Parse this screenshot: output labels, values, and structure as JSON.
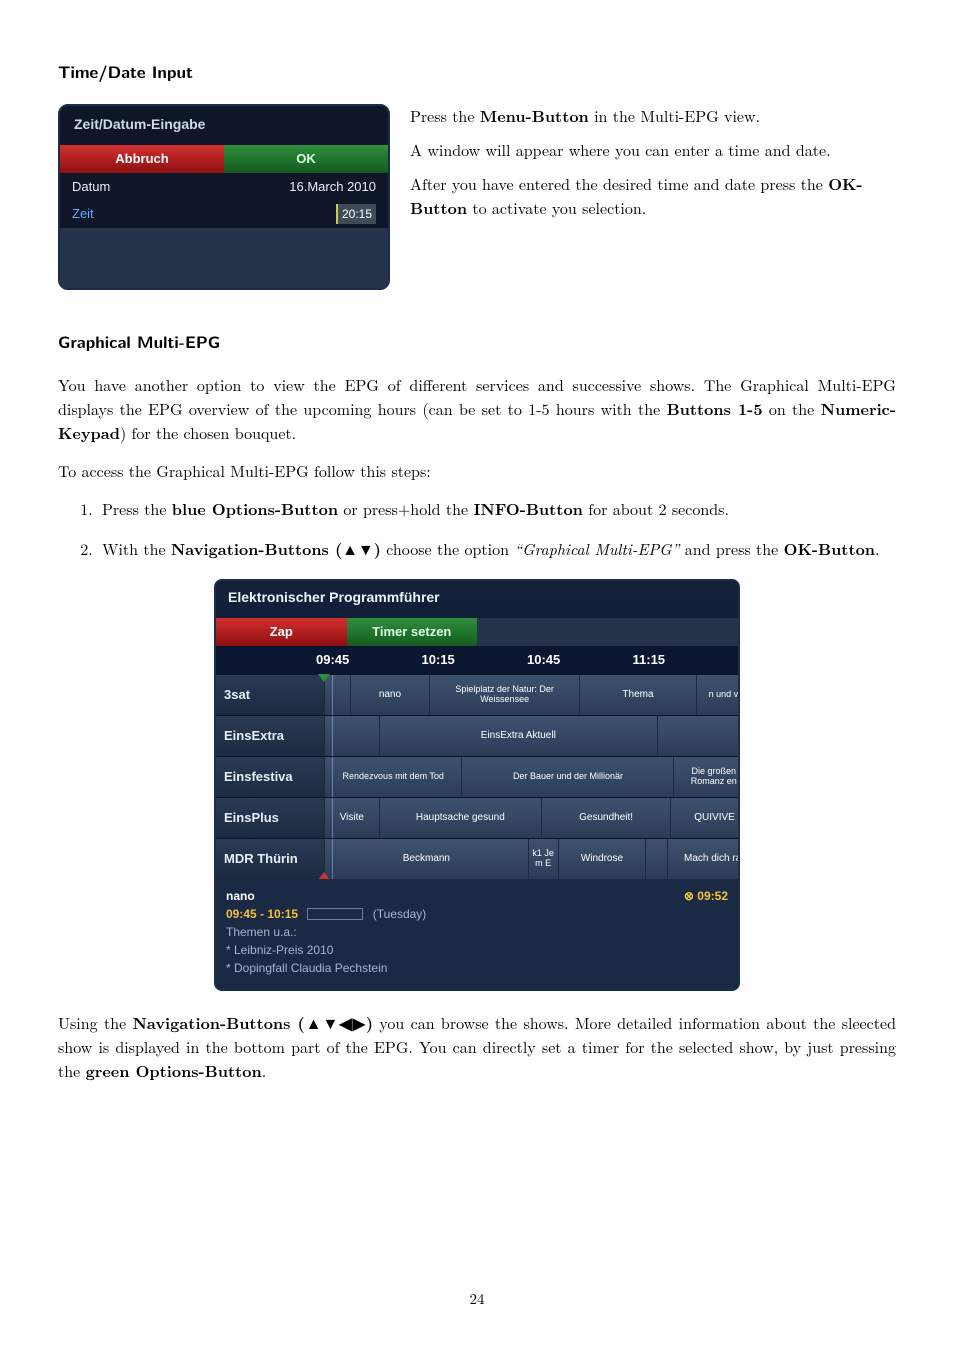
{
  "section1_title": "Time/Date Input",
  "td_panel": {
    "title": "Zeit/Datum-Eingabe",
    "btn_abort": "Abbruch",
    "btn_ok": "OK",
    "row_date_label": "Datum",
    "row_date_value": "16.March 2010",
    "row_time_label": "Zeit",
    "row_time_value": "20:15"
  },
  "td_text": {
    "p1a": "Press the ",
    "p1b": "Menu-Button",
    "p1c": " in the Multi-EPG view.",
    "p2": "A window will appear where you can enter a time and date.",
    "p3a": "After you have entered the desired time and date press the ",
    "p3b": "OK-Button",
    "p3c": " to activate you selection."
  },
  "section2_title": "Graphical Multi-EPG",
  "gmepg_intro_a": "You have another option to view the EPG of different services and successive shows. The Graphical Multi-EPG displays the EPG overview of the upcoming hours (can be set to 1-5 hours with the ",
  "gmepg_intro_b": "Buttons 1-5",
  "gmepg_intro_c": " on the ",
  "gmepg_intro_d": "Numeric-Keypad",
  "gmepg_intro_e": ") for the chosen bouquet.",
  "gmepg_follow": "To access the Graphical Multi-EPG follow this steps:",
  "step1_a": "Press the ",
  "step1_b": "blue Options-Button",
  "step1_c": " or press+hold the ",
  "step1_d": "INFO-Button",
  "step1_e": " for about 2 seconds.",
  "step2_a": "With the ",
  "step2_b": "Navigation-Buttons (▲▼)",
  "step2_c": " choose the option ",
  "step2_d": "“Graphical Multi-EPG”",
  "step2_e": " and press the ",
  "step2_f": "OK-Button",
  "step2_g": ".",
  "epg": {
    "title": "Elektronischer Programmführer",
    "btn_zap": "Zap",
    "btn_timer": "Timer setzen",
    "times": [
      "09:45",
      "10:15",
      "10:45",
      "11:15"
    ],
    "channels": [
      "3sat",
      "EinsExtra",
      "Einsfestiva",
      "EinsPlus",
      "MDR Thürin"
    ],
    "rows": {
      "3sat": {
        "c1": "nano",
        "c2": "Spielplatz der Natur: Der Weissensee",
        "c3": "Thema",
        "c4": "n und verg"
      },
      "einsextra": {
        "c1": "EinsExtra Aktuell"
      },
      "einsfestiva": {
        "c1": "Rendezvous mit dem Tod",
        "c2": "Der Bauer und der Millionär",
        "c3": "Die großen Romanz en"
      },
      "einsplus": {
        "c1": "Visite",
        "c2": "Hauptsache gesund",
        "c3": "Gesundheit!",
        "c4": "QUIVIVE"
      },
      "mdr": {
        "c1": "Beckmann",
        "c2": "k1 Je m E",
        "c3": "Windrose",
        "c4": "Mach dich ran"
      }
    },
    "footer": {
      "title": "nano",
      "timerange": "09:45 - 10:15",
      "day": "(Tuesday)",
      "sub1": "Themen u.a.:",
      "sub2": "* Leibniz-Preis 2010",
      "sub3": "* Dopingfall Claudia Pechstein",
      "clock": "⊗ 09:52"
    }
  },
  "closing_a": "Using the ",
  "closing_b": "Navigation-Buttons (▲▼◀▶)",
  "closing_c": " you can browse the shows. More detailed information about the sleected show is displayed in the bottom part of the EPG. You can directly set a timer for the selected show, by just pressing the ",
  "closing_d": "green Options-Button",
  "closing_e": ".",
  "page_number": "24"
}
